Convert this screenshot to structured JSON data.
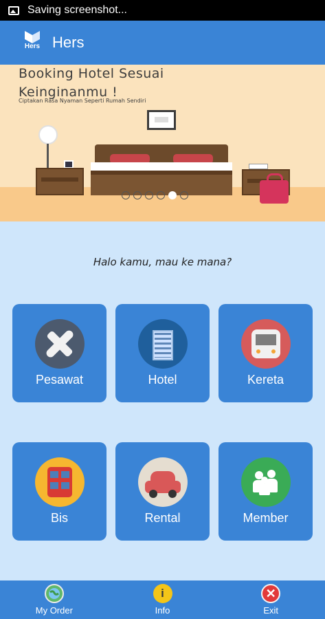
{
  "status_bar": {
    "text": "Saving screenshot..."
  },
  "app_bar": {
    "title": "Hers",
    "logo_text": "Hers"
  },
  "banner": {
    "title_line1": "Booking Hotel Sesuai",
    "title_line2": "Keinginanmu !",
    "subtitle": "Ciptakan Rasa Nyaman Seperti Rumah Sendiri",
    "slide_count": 6,
    "active_slide": 5
  },
  "greeting": "Halo kamu, mau ke mana?",
  "tiles": [
    {
      "label": "Pesawat",
      "icon": "airplane-icon",
      "circle_color": "#4c5a6e"
    },
    {
      "label": "Hotel",
      "icon": "hotel-building-icon",
      "circle_color": "#1f5f9c"
    },
    {
      "label": "Kereta",
      "icon": "train-icon",
      "circle_color": "#d65b5b"
    },
    {
      "label": "Bis",
      "icon": "bus-icon",
      "circle_color": "#f6b730"
    },
    {
      "label": "Rental",
      "icon": "car-icon",
      "circle_color": "#e5ddd0"
    },
    {
      "label": "Member",
      "icon": "people-group-icon",
      "circle_color": "#3aab56"
    }
  ],
  "bottom_nav": [
    {
      "label": "My Order",
      "icon": "globe-order-icon"
    },
    {
      "label": "Info",
      "icon": "info-icon"
    },
    {
      "label": "Exit",
      "icon": "exit-x-icon"
    }
  ],
  "colors": {
    "primary": "#3a84d6",
    "background": "#cfe6fb",
    "banner_bg": "#fbe3bd"
  }
}
